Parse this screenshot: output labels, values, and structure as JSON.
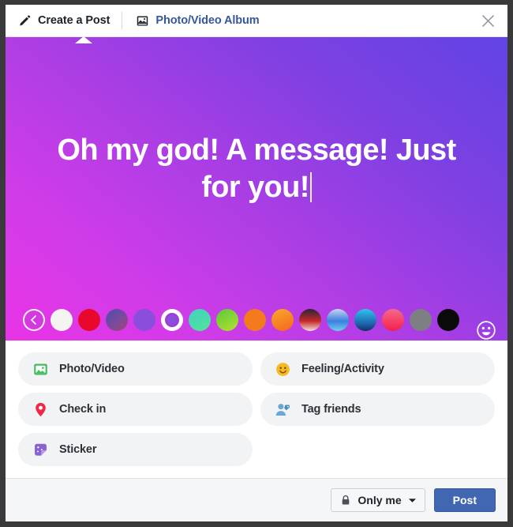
{
  "header": {
    "tabs": [
      {
        "label": "Create a Post",
        "icon": "pencil-icon",
        "active": true
      },
      {
        "label": "Photo/Video Album",
        "icon": "photo-album-icon",
        "active": false
      }
    ],
    "close_icon": "close-icon"
  },
  "composer": {
    "post_text": "Oh my god! A message! Just for you!",
    "caret_visible": true,
    "emoji_icon": "emoji-smiley-icon",
    "background": {
      "type": "gradient",
      "from": "#e934e6",
      "to": "#6143e4"
    }
  },
  "palette": {
    "back_icon": "chevron-left-icon",
    "selected_index": 4,
    "swatches": [
      {
        "name": "white",
        "css": "#f4f5f0"
      },
      {
        "name": "red",
        "css": "#e8082c"
      },
      {
        "name": "purple-slate",
        "css": "linear-gradient(140deg,#4b4fa8 0%,#7b4a9e 55%,#a3456f 100%)"
      },
      {
        "name": "purple-selected",
        "css": "#8b4ddb"
      },
      {
        "name": "blue",
        "css": "#4f9fe0"
      },
      {
        "name": "teal-green",
        "css": "linear-gradient(150deg,#3fd2c0 0%,#55e39a 100%)"
      },
      {
        "name": "green-yellow",
        "css": "linear-gradient(150deg,#57c93f 0%,#b8e02c 100%)"
      },
      {
        "name": "orange",
        "css": "#f47a1e"
      },
      {
        "name": "orange-yellow",
        "css": "linear-gradient(160deg,#f9a82c 0%,#f4651e 100%)"
      },
      {
        "name": "dark-red-white",
        "css": "linear-gradient(180deg,#2a2438 0%,#c42a2a 55%,#f4e0d8 100%)"
      },
      {
        "name": "blue-sky",
        "css": "linear-gradient(180deg,#c9d6f0 0%,#3a7fe0 55%,#6fd0ee 100%)"
      },
      {
        "name": "cyan-navy",
        "css": "linear-gradient(180deg,#2fc4ee 0%,#1d5fa8 70%,#12305e 100%)"
      },
      {
        "name": "pink-red",
        "css": "linear-gradient(180deg,#f46a8a 0%,#f41e4e 100%)"
      },
      {
        "name": "gray",
        "css": "#7d8083"
      },
      {
        "name": "black",
        "css": "#0a0a0a"
      }
    ]
  },
  "actions": [
    {
      "label": "Photo/Video",
      "icon": "photo-video-icon"
    },
    {
      "label": "Feeling/Activity",
      "icon": "feeling-activity-icon"
    },
    {
      "label": "Check in",
      "icon": "location-pin-icon"
    },
    {
      "label": "Tag friends",
      "icon": "tag-friends-icon"
    },
    {
      "label": "Sticker",
      "icon": "sticker-icon"
    }
  ],
  "footer": {
    "privacy_label": "Only me",
    "privacy_icon": "lock-icon",
    "privacy_chevron_icon": "chevron-down-icon",
    "post_label": "Post",
    "post_color": "#4267b2"
  }
}
